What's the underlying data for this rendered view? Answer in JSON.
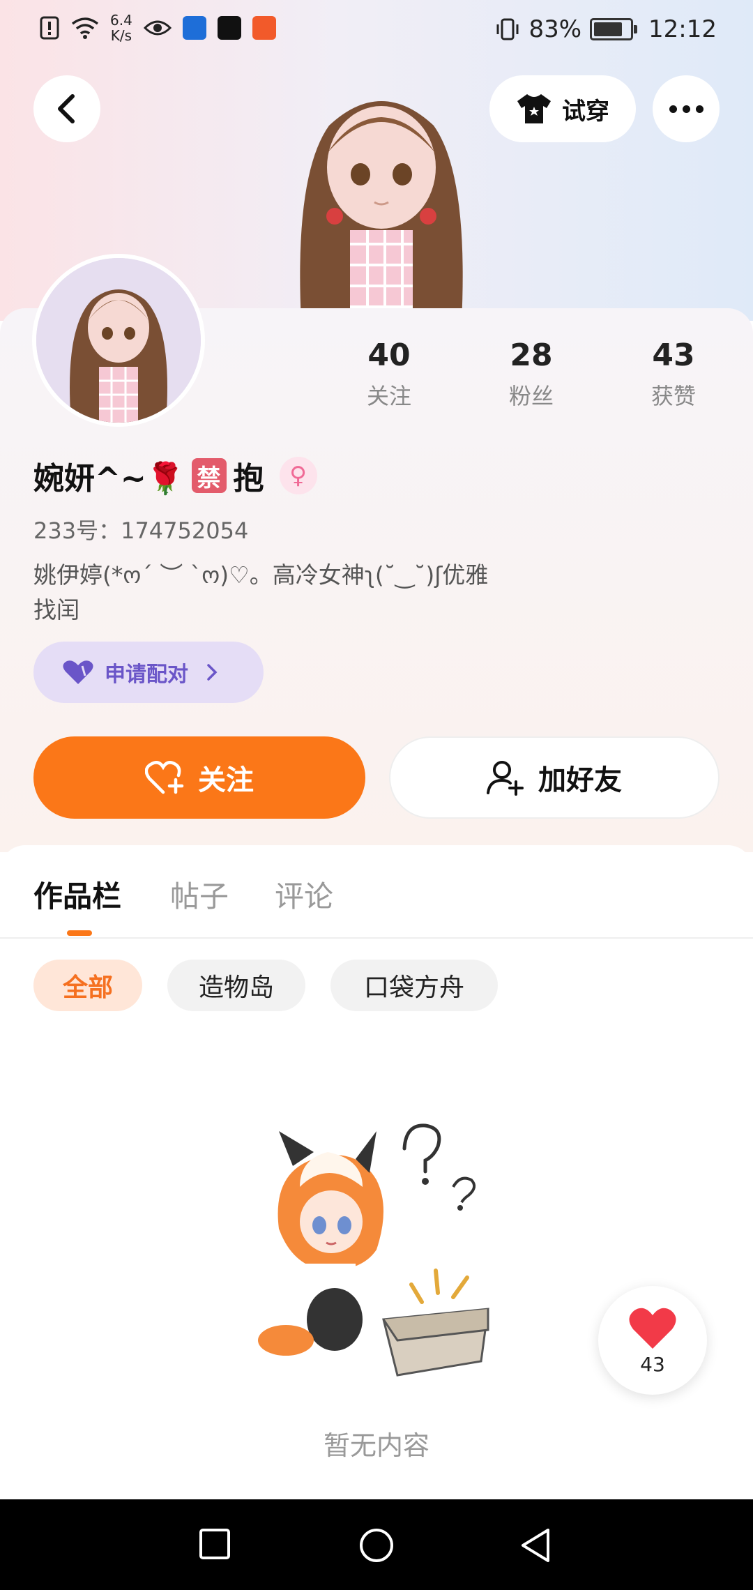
{
  "status_bar": {
    "net_speed": "6.4",
    "net_unit": "K/s",
    "battery": "83%",
    "time": "12:12"
  },
  "header": {
    "tryon_label": "试穿"
  },
  "profile": {
    "nickname": "婉妍^~🌹",
    "nickname_tag": "禁",
    "nickname_suffix": "抱",
    "id_label": "233号：174752054",
    "bio": "姚伊婷(*ო´ ︶ `ო)♡。高冷女神ʅ(˘‿˘)ʃ优雅\n找闰",
    "pair_label": "申请配对",
    "stats": [
      {
        "value": "40",
        "label": "关注"
      },
      {
        "value": "28",
        "label": "粉丝"
      },
      {
        "value": "43",
        "label": "获赞"
      }
    ]
  },
  "actions": {
    "follow_label": "关注",
    "add_friend_label": "加好友"
  },
  "tabs": [
    {
      "label": "作品栏"
    },
    {
      "label": "帖子"
    },
    {
      "label": "评论"
    }
  ],
  "filters": [
    {
      "label": "全部"
    },
    {
      "label": "造物岛"
    },
    {
      "label": "口袋方舟"
    }
  ],
  "empty_state": {
    "text": "暂无内容"
  },
  "like_float": {
    "count": "43"
  },
  "colors": {
    "accent": "#fb7718",
    "pair_purple": "#6a55c8"
  }
}
